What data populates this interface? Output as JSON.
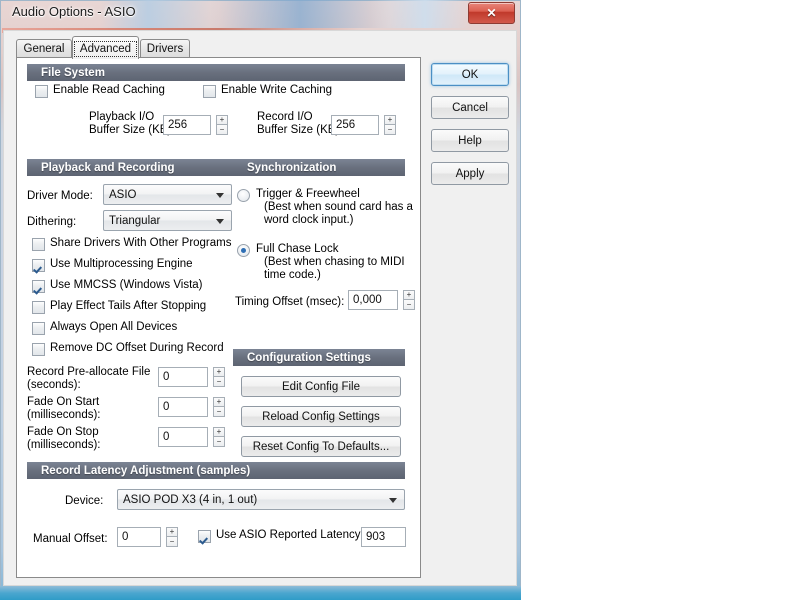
{
  "window": {
    "title": "Audio Options - ASIO",
    "close_icon": "close-icon",
    "close_glyph": "✕"
  },
  "tabs": [
    {
      "label": "General",
      "active": false
    },
    {
      "label": "Advanced",
      "active": true
    },
    {
      "label": "Drivers",
      "active": false
    }
  ],
  "dialog_buttons": {
    "ok": "OK",
    "cancel": "Cancel",
    "help": "Help",
    "apply": "Apply"
  },
  "sections": {
    "file_system": {
      "header": "File System",
      "enable_read_caching": {
        "label": "Enable Read Caching",
        "checked": false
      },
      "enable_write_caching": {
        "label": "Enable Write Caching",
        "checked": false
      },
      "playback_buffer": {
        "label_line1": "Playback I/O",
        "label_line2": "Buffer Size (KB):",
        "value": "256"
      },
      "record_buffer": {
        "label_line1": "Record I/O",
        "label_line2": "Buffer Size (KB):",
        "value": "256"
      }
    },
    "playback_recording": {
      "header": "Playback and Recording",
      "driver_mode": {
        "label": "Driver Mode:",
        "value": "ASIO"
      },
      "dithering": {
        "label": "Dithering:",
        "value": "Triangular"
      },
      "checkboxes": [
        {
          "label": "Share Drivers With Other Programs",
          "checked": false
        },
        {
          "label": "Use Multiprocessing Engine",
          "checked": true
        },
        {
          "label": "Use MMCSS (Windows Vista)",
          "checked": true
        },
        {
          "label": "Play Effect Tails After Stopping",
          "checked": false
        },
        {
          "label": "Always Open All Devices",
          "checked": false
        },
        {
          "label": "Remove DC Offset During Record",
          "checked": false
        }
      ],
      "record_prealloc": {
        "label_line1": "Record Pre-allocate File",
        "label_line2": "(seconds):",
        "value": "0"
      },
      "fade_on_start": {
        "label_line1": "Fade On Start",
        "label_line2": "(milliseconds):",
        "value": "0"
      },
      "fade_on_stop": {
        "label_line1": "Fade On Stop",
        "label_line2": "(milliseconds):",
        "value": "0"
      }
    },
    "synchronization": {
      "header": "Synchronization",
      "trigger_freewheel": {
        "label": "Trigger & Freewheel",
        "hint_line1": "(Best when sound card has a",
        "hint_line2": "word clock input.)",
        "selected": false
      },
      "full_chase_lock": {
        "label": "Full Chase Lock",
        "hint_line1": "(Best when chasing to MIDI",
        "hint_line2": "time code.)",
        "selected": true
      },
      "timing_offset": {
        "label": "Timing Offset (msec):",
        "value": "0,000"
      }
    },
    "configuration_settings": {
      "header": "Configuration Settings",
      "buttons": [
        "Edit Config File",
        "Reload Config Settings",
        "Reset Config To Defaults..."
      ]
    },
    "record_latency": {
      "header": "Record Latency Adjustment (samples)",
      "device": {
        "label": "Device:",
        "value": "ASIO POD X3 (4 in, 1 out)"
      },
      "manual_offset": {
        "label": "Manual Offset:",
        "value": "0"
      },
      "use_asio_reported": {
        "label": "Use ASIO Reported Latency:",
        "checked": true,
        "value": "903"
      }
    }
  },
  "spinner": {
    "up": "+",
    "down": "−"
  }
}
